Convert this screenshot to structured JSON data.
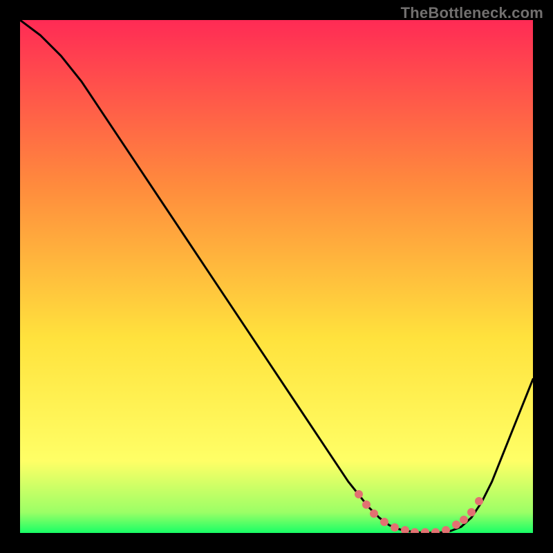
{
  "watermark": "TheBottleneck.com",
  "colors": {
    "background_black": "#000000",
    "gradient_top": "#ff2b55",
    "gradient_mid1": "#ff8a3d",
    "gradient_mid2": "#ffe23d",
    "gradient_mid3": "#ffff66",
    "gradient_bottom": "#18ff66",
    "line": "#000000",
    "marker": "#e27171",
    "watermark": "#72706f"
  },
  "chart_data": {
    "type": "line",
    "title": "",
    "xlabel": "",
    "ylabel": "",
    "xlim": [
      0,
      100
    ],
    "ylim": [
      0,
      100
    ],
    "series": [
      {
        "name": "bottleneck-curve",
        "x": [
          0,
          4,
          8,
          12,
          16,
          20,
          24,
          28,
          32,
          36,
          40,
          44,
          48,
          52,
          56,
          60,
          64,
          68,
          70,
          72,
          74,
          76,
          78,
          80,
          82,
          84,
          86,
          88,
          90,
          92,
          94,
          96,
          98,
          100
        ],
        "y": [
          100,
          97,
          93,
          88,
          82,
          76,
          70,
          64,
          58,
          52,
          46,
          40,
          34,
          28,
          22,
          16,
          10,
          5,
          3,
          1.5,
          0.7,
          0.3,
          0.1,
          0.05,
          0.1,
          0.4,
          1.2,
          3,
          6,
          10,
          15,
          20,
          25,
          30
        ]
      }
    ],
    "markers": {
      "name": "highlight-points",
      "x": [
        66,
        67.5,
        69,
        71,
        73,
        75,
        77,
        79,
        81,
        83,
        85,
        86.5,
        88,
        89.5
      ],
      "y": [
        7.5,
        5.5,
        3.8,
        2.2,
        1.1,
        0.5,
        0.2,
        0.1,
        0.15,
        0.6,
        1.6,
        2.6,
        4.1,
        6.2
      ]
    },
    "gradient_stops": [
      {
        "offset": 0,
        "color": "#ff2b55"
      },
      {
        "offset": 32,
        "color": "#ff8a3d"
      },
      {
        "offset": 62,
        "color": "#ffe23d"
      },
      {
        "offset": 86,
        "color": "#ffff66"
      },
      {
        "offset": 96,
        "color": "#9bff66"
      },
      {
        "offset": 100,
        "color": "#18ff66"
      }
    ]
  }
}
